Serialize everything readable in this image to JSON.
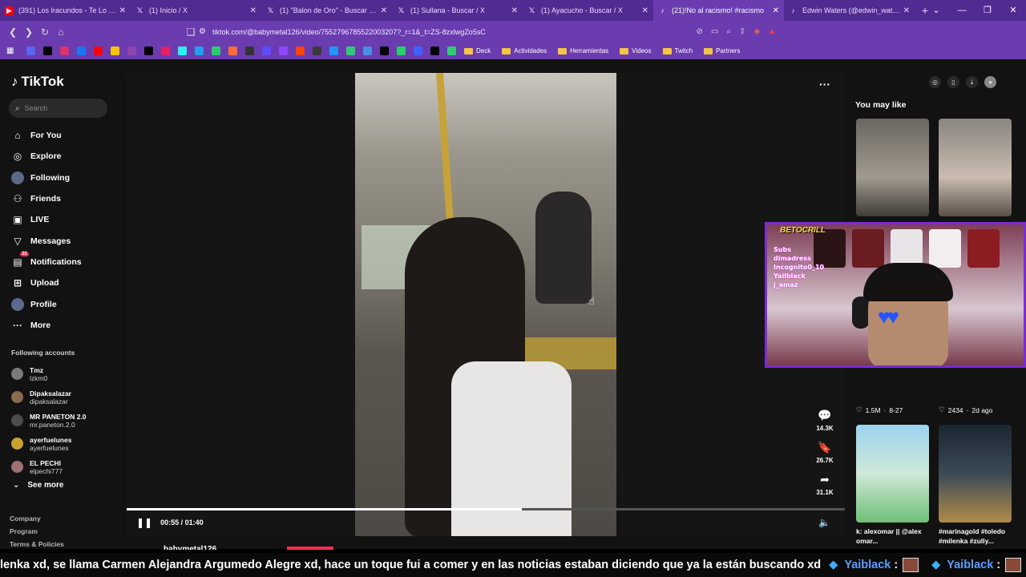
{
  "browser": {
    "tabs": [
      {
        "title": "(391) Los Iracundos - Te Lo Pido de",
        "icon": "youtube-icon",
        "color": "#ff0000",
        "glyph": "▶"
      },
      {
        "title": "(1) Inicio / X",
        "icon": "x-icon",
        "color": "#000000",
        "glyph": "𝕏"
      },
      {
        "title": "(1) \"Balon de Oro\" - Buscar / X",
        "icon": "x-icon",
        "color": "#000000",
        "glyph": "𝕏"
      },
      {
        "title": "(1) Sullana - Buscar / X",
        "icon": "x-icon",
        "color": "#000000",
        "glyph": "𝕏"
      },
      {
        "title": "(1) Ayacucho - Buscar / X",
        "icon": "x-icon",
        "color": "#000000",
        "glyph": "𝕏"
      },
      {
        "title": "(21)!No al racismo! #racismo",
        "icon": "tiktok-icon",
        "color": "#000000",
        "glyph": "♪",
        "active": true
      },
      {
        "title": "Edwin Waters (@edwin_waters) | Tik",
        "icon": "tiktok-icon",
        "color": "#000000",
        "glyph": "♪"
      }
    ],
    "new_tab": "+",
    "url": "tiktok.com/@babymetal126/video/7552796785522003207?_r=1&_t=ZS-8zxlwgZo5sC",
    "bookmarks": [
      "Deck",
      "Actividades",
      "Herramientas",
      "Videos",
      "Twitch",
      "Partners"
    ],
    "bookmark_icon_colors": [
      "#5865f2",
      "#000000",
      "#e1306c",
      "#1877f2",
      "#ff0000",
      "#f7c600",
      "#8e44ad",
      "#000000",
      "#e91e63",
      "#25f4ee",
      "#1da1f2",
      "#2ecc71",
      "#ff6b35",
      "#333333",
      "#5e4bff",
      "#9146ff",
      "#ff4500",
      "#3a3a3a",
      "#2196f3",
      "#2ecc71",
      "#4a90e2",
      "#000000",
      "#25d366",
      "#4060ff",
      "#000000",
      "#2ecc71"
    ]
  },
  "tiktok": {
    "logo": "TikTok",
    "search_placeholder": "Search",
    "nav": [
      {
        "label": "For You",
        "icon": "home-icon",
        "glyph": "⌂"
      },
      {
        "label": "Explore",
        "icon": "compass-icon",
        "glyph": "◎"
      },
      {
        "label": "Following",
        "icon": "following-avatar-icon",
        "glyph": "●"
      },
      {
        "label": "Friends",
        "icon": "friends-icon",
        "glyph": "⚇"
      },
      {
        "label": "LIVE",
        "icon": "live-icon",
        "glyph": "▣"
      },
      {
        "label": "Messages",
        "icon": "messages-icon",
        "glyph": "▽"
      },
      {
        "label": "Notifications",
        "icon": "notifications-icon",
        "glyph": "▤",
        "badge": "31"
      },
      {
        "label": "Upload",
        "icon": "upload-icon",
        "glyph": "⊞"
      },
      {
        "label": "Profile",
        "icon": "profile-avatar-icon",
        "glyph": "●"
      },
      {
        "label": "More",
        "icon": "more-icon",
        "glyph": "···"
      }
    ],
    "following_header": "Following accounts",
    "following": [
      {
        "name": "Tmz",
        "handle": "lzkm0",
        "color": "#7a7a7a"
      },
      {
        "name": "Dipaksalazar",
        "handle": "dipaksalazar",
        "color": "#8a6b4e"
      },
      {
        "name": "MR PANETON 2.0",
        "handle": "mr.paneton.2.0",
        "color": "#4c4c4c"
      },
      {
        "name": "ayerfuelunes",
        "handle": "ayerfuelunes",
        "color": "#c7a22d"
      },
      {
        "name": "EL PECHI",
        "handle": "elpechi777",
        "color": "#a07070"
      }
    ],
    "see_more": "See more",
    "footer_links": [
      "Company",
      "Program",
      "Terms & Policies"
    ],
    "video": {
      "time": "00:55 / 01:40",
      "progress": 0.55,
      "author_partial": "babymetal126"
    },
    "actions": [
      {
        "icon": "comment-icon",
        "glyph": "💬",
        "count": "14.3K"
      },
      {
        "icon": "bookmark-icon",
        "glyph": "🔖",
        "count": "26.7K"
      },
      {
        "icon": "share-icon",
        "glyph": "➦",
        "count": "31.1K"
      }
    ],
    "you_may_like": "You may like",
    "recommendations": [
      {
        "likes": "1.5M",
        "date": "8-27",
        "caption": ""
      },
      {
        "likes": "2434",
        "date": "2d ago",
        "caption": ""
      },
      {
        "caption": "k: alexomar || @alex omar..."
      },
      {
        "caption": "#marinagold #toledo #milenka #zully..."
      }
    ]
  },
  "stream": {
    "cam_logo": "BETOCRILL",
    "cam_lines": [
      "Subs",
      "dimadress",
      "Incognito0_10",
      "Yailblack",
      "j_amaz"
    ],
    "chat_text": "lenka xd, se llama Carmen Alejandra Argumedo Alegre xd, hace un toque fui a comer y en las noticias estaban diciendo que ya la están buscando xd",
    "chat_users": [
      "Yaiblack",
      "Yaiblack"
    ],
    "chat_separator": ":"
  },
  "colors": {
    "browser_purple": "#6a3cb0",
    "tab_purple": "#512b91",
    "tiktok_bg": "#121212",
    "accent_red": "#fe2c55",
    "cam_border": "#7b2bd6"
  }
}
